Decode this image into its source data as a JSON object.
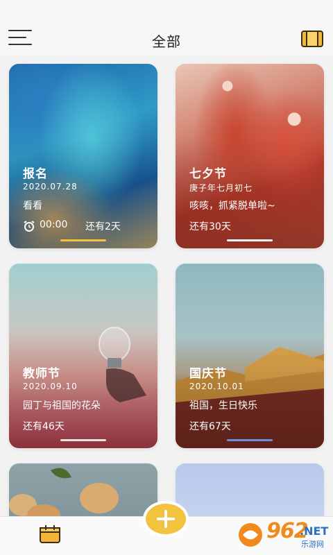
{
  "header": {
    "title": "全部",
    "menu_icon": "hamburger-menu-icon",
    "wallet_icon": "wallet-icon"
  },
  "cards": [
    {
      "title": "报名",
      "date": "2020.07.28",
      "note": "看看",
      "time": "00:00",
      "remain": "还有2天",
      "indicator_color": "#f2c33d"
    },
    {
      "title": "七夕节",
      "date": "庚子年七月初七",
      "note": "咳咳，抓紧脱单啦~",
      "remain": "还有30天",
      "indicator_color": "#f4f4f4"
    },
    {
      "title": "教师节",
      "date": "2020.09.10",
      "note": "园丁与祖国的花朵",
      "remain": "还有46天",
      "indicator_color": "#e8e0e2"
    },
    {
      "title": "国庆节",
      "date": "2020.10.01",
      "note": "祖国，生日快乐",
      "remain": "还有67天",
      "indicator_color": "#6f8ed8"
    }
  ],
  "bottom_nav": {
    "calendar_icon": "calendar-icon",
    "add_icon": "plus-icon"
  },
  "watermark": {
    "number": "962",
    "suffix": ".NET",
    "sub": "乐游网"
  },
  "colors": {
    "accent": "#f3c33f"
  }
}
